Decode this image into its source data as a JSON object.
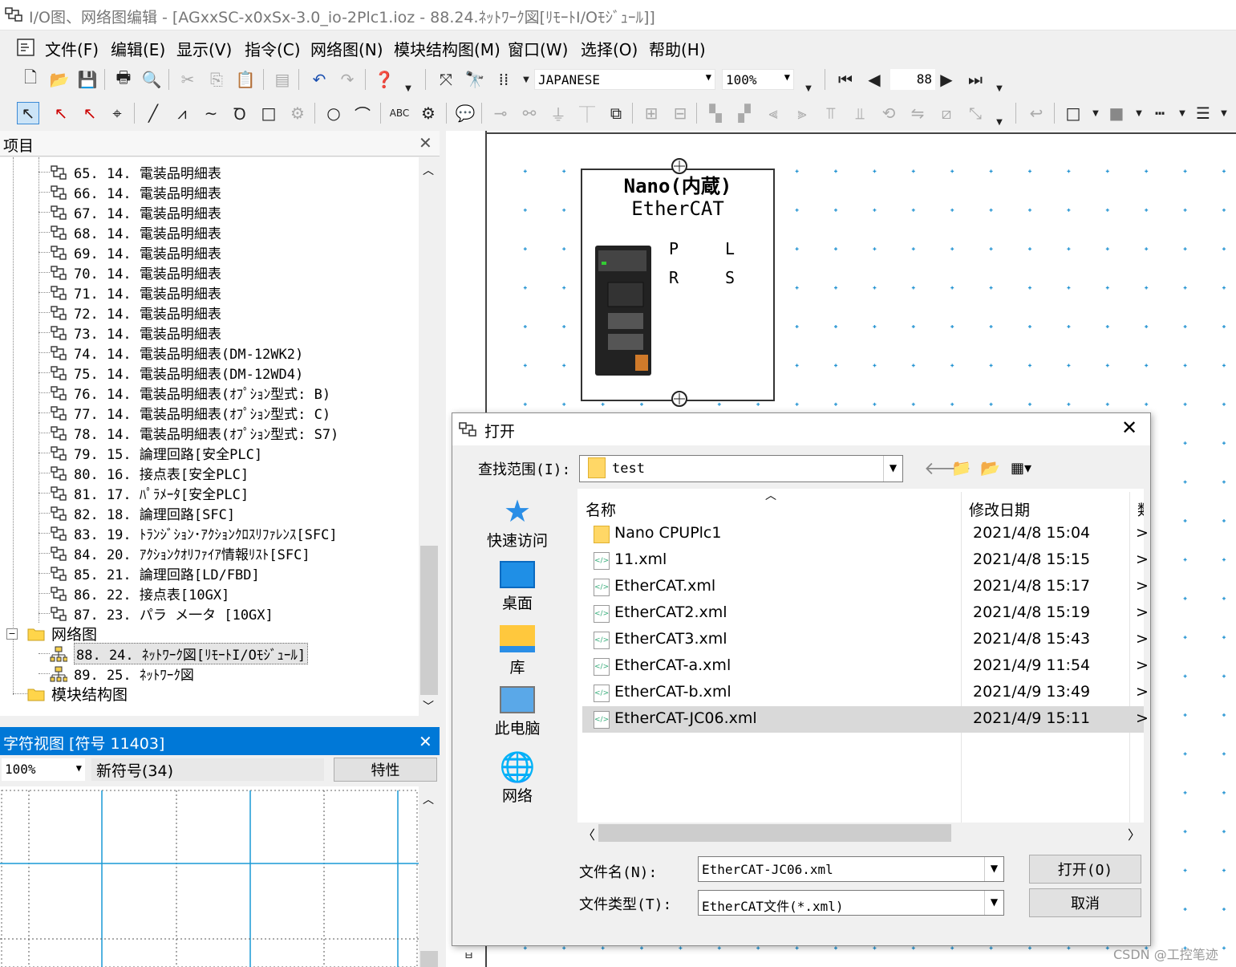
{
  "window": {
    "title": "I/O图、网络图编辑 - [AGxxSC-x0xSx-3.0_io-2Plc1.ioz - 88.24.ﾈｯﾄﾜｰｸ図[ﾘﾓｰﾄI/Oﾓｼﾞｭｰﾙ]]"
  },
  "menu": [
    "文件(F)",
    "编辑(E)",
    "显示(V)",
    "指令(C)",
    "网络图(N)",
    "模块结构图(M)",
    "窗口(W)",
    "选择(O)",
    "帮助(H)"
  ],
  "toolbar": {
    "language": "JAPANESE",
    "zoom": "100%",
    "page_number": "88"
  },
  "project_panel": {
    "title": "项目",
    "items": [
      "65. 14. 電装品明細表",
      "66. 14. 電装品明細表",
      "67. 14. 電装品明細表",
      "68. 14. 電装品明細表",
      "69. 14. 電装品明細表",
      "70. 14. 電装品明細表",
      "71. 14. 電装品明細表",
      "72. 14. 電装品明細表",
      "73. 14. 電装品明細表",
      "74. 14. 電装品明細表(DM-12WK2)",
      "75. 14. 電装品明細表(DM-12WD4)",
      "76. 14. 電装品明細表(ｵﾌﾟｼｮﾝ型式: B)",
      "77. 14. 電装品明細表(ｵﾌﾟｼｮﾝ型式: C)",
      "78. 14. 電装品明細表(ｵﾌﾟｼｮﾝ型式: S7)",
      "79. 15. 論理回路[安全PLC]",
      "80. 16. 接点表[安全PLC]",
      "81. 17. ﾊﾟﾗﾒｰﾀ[安全PLC]",
      "82. 18. 論理回路[SFC]",
      "83. 19. ﾄﾗﾝｼﾞｼｮﾝ･ｱｸｼｮﾝｸﾛｽﾘﾌｧﾚﾝｽ[SFC]",
      "84. 20. ｱｸｼｮﾝｸｵﾘﾌｧｲｱ情報ﾘｽﾄ[SFC]",
      "85. 21. 論理回路[LD/FBD]",
      "86. 22. 接点表[10GX]",
      "87. 23. パラ メ一タ [10GX]"
    ],
    "network_folder": "网络图",
    "network_items": [
      "88. 24. ﾈｯﾄﾜｰｸ図[ﾘﾓｰﾄI/Oﾓｼﾞｭｰﾙ]",
      "89. 25. ﾈｯﾄﾜｰｸ図"
    ],
    "module_folder": "模块结构图"
  },
  "symbol_panel": {
    "title": "字符视图 [符号 11403]",
    "zoom": "100%",
    "new_symbol": "新符号(34)",
    "properties_button": "特性"
  },
  "canvas": {
    "block_title": "Nano(内蔵)",
    "block_subtitle": "EtherCAT",
    "pins": [
      "P",
      "L",
      "R",
      "S"
    ]
  },
  "dialog": {
    "title": "打开",
    "lookin_label": "查找范围(I):",
    "lookin_value": "test",
    "places": [
      "快速访问",
      "桌面",
      "库",
      "此电脑",
      "网络"
    ],
    "columns": {
      "name": "名称",
      "date": "修改日期"
    },
    "files": [
      {
        "name": "Nano CPUPlc1",
        "date": "2021/4/8 15:04",
        "type": "folder"
      },
      {
        "name": "11.xml",
        "date": "2021/4/8 15:15",
        "type": "xml"
      },
      {
        "name": "EtherCAT.xml",
        "date": "2021/4/8 15:17",
        "type": "xml"
      },
      {
        "name": "EtherCAT2.xml",
        "date": "2021/4/8 15:19",
        "type": "xml"
      },
      {
        "name": "EtherCAT3.xml",
        "date": "2021/4/8 15:43",
        "type": "xml"
      },
      {
        "name": "EtherCAT-a.xml",
        "date": "2021/4/9 11:54",
        "type": "xml"
      },
      {
        "name": "EtherCAT-b.xml",
        "date": "2021/4/9 13:49",
        "type": "xml"
      },
      {
        "name": "EtherCAT-JC06.xml",
        "date": "2021/4/9 15:11",
        "type": "xml",
        "selected": true
      }
    ],
    "filename_label": "文件名(N):",
    "filename_value": "EtherCAT-JC06.xml",
    "filetype_label": "文件类型(T):",
    "filetype_value": "EtherCAT文件(*.xml)",
    "open_button": "打开(O)",
    "cancel_button": "取消"
  },
  "watermark": "CSDN @工控笔迹"
}
